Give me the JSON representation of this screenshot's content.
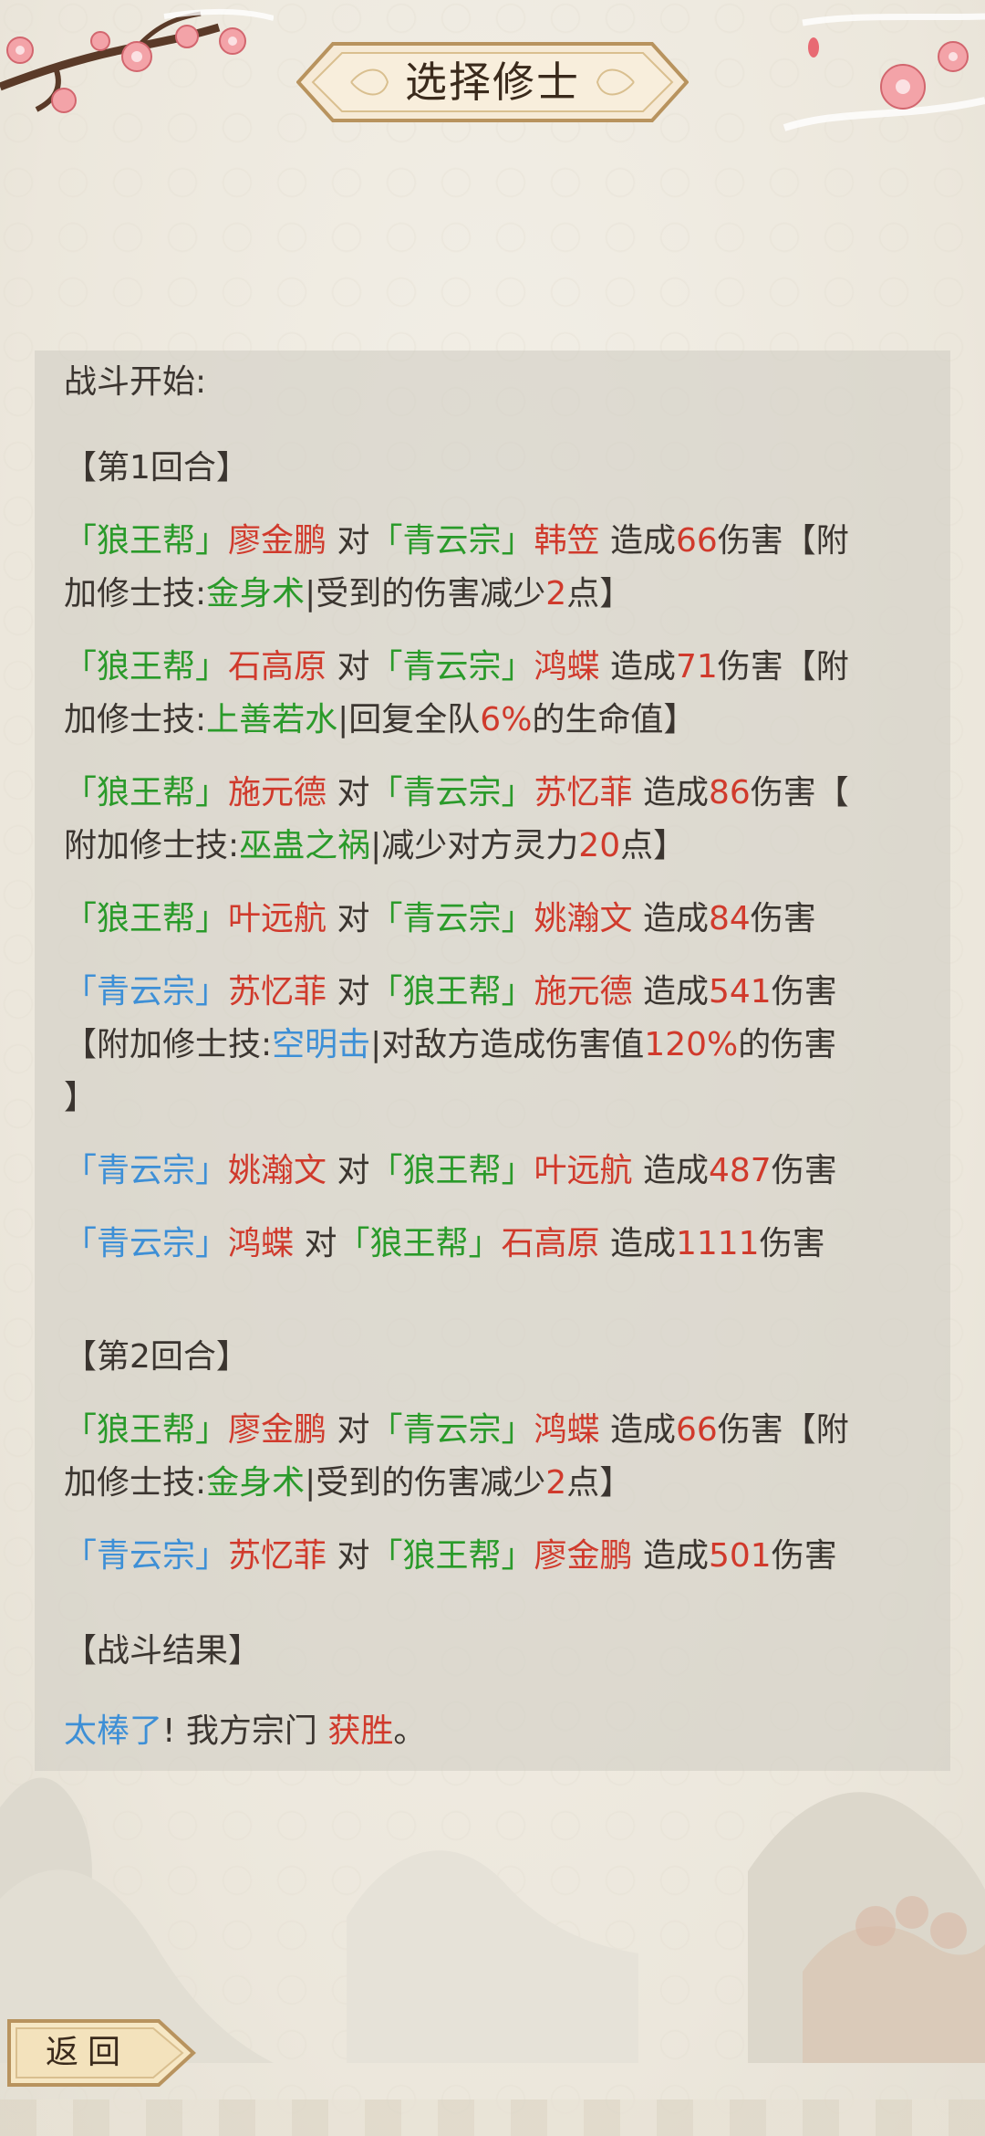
{
  "header": {
    "title": "选择修士"
  },
  "log": {
    "intro": "战斗开始:",
    "rounds": [
      {
        "title": "【第1回合】",
        "entries": [
          {
            "line1": [
              {
                "text": "「狼王帮」",
                "color": "green"
              },
              {
                "text": "廖金鹏",
                "color": "red"
              },
              {
                "text": " 对",
                "color": "plain"
              },
              {
                "text": "「青云宗」",
                "color": "green"
              },
              {
                "text": "韩笠",
                "color": "red"
              },
              {
                "text": " 造成",
                "color": "plain"
              },
              {
                "text": "66",
                "color": "red"
              },
              {
                "text": "伤害【附",
                "color": "plain"
              }
            ],
            "line2": [
              {
                "text": "加修士技:",
                "color": "plain"
              },
              {
                "text": "金身术",
                "color": "green"
              },
              {
                "text": "|受到的伤害减少",
                "color": "plain"
              },
              {
                "text": "2",
                "color": "red"
              },
              {
                "text": "点】",
                "color": "plain"
              }
            ]
          },
          {
            "line1": [
              {
                "text": "「狼王帮」",
                "color": "green"
              },
              {
                "text": "石高原",
                "color": "red"
              },
              {
                "text": " 对",
                "color": "plain"
              },
              {
                "text": "「青云宗」",
                "color": "green"
              },
              {
                "text": "鸿蝶",
                "color": "red"
              },
              {
                "text": " 造成",
                "color": "plain"
              },
              {
                "text": "71",
                "color": "red"
              },
              {
                "text": "伤害【附",
                "color": "plain"
              }
            ],
            "line2": [
              {
                "text": "加修士技:",
                "color": "plain"
              },
              {
                "text": "上善若水",
                "color": "green"
              },
              {
                "text": "|回复全队",
                "color": "plain"
              },
              {
                "text": "6%",
                "color": "red"
              },
              {
                "text": "的生命值】",
                "color": "plain"
              }
            ]
          },
          {
            "line1": [
              {
                "text": "「狼王帮」",
                "color": "green"
              },
              {
                "text": "施元德",
                "color": "red"
              },
              {
                "text": " 对",
                "color": "plain"
              },
              {
                "text": "「青云宗」",
                "color": "green"
              },
              {
                "text": "苏忆菲",
                "color": "red"
              },
              {
                "text": " 造成",
                "color": "plain"
              },
              {
                "text": "86",
                "color": "red"
              },
              {
                "text": "伤害【",
                "color": "plain"
              }
            ],
            "line2": [
              {
                "text": "附加修士技:",
                "color": "plain"
              },
              {
                "text": "巫蛊之祸",
                "color": "green"
              },
              {
                "text": "|减少对方灵力",
                "color": "plain"
              },
              {
                "text": "20",
                "color": "red"
              },
              {
                "text": "点】",
                "color": "plain"
              }
            ]
          },
          {
            "line1": [
              {
                "text": "「狼王帮」",
                "color": "green"
              },
              {
                "text": "叶远航",
                "color": "red"
              },
              {
                "text": " 对",
                "color": "plain"
              },
              {
                "text": "「青云宗」",
                "color": "green"
              },
              {
                "text": "姚瀚文",
                "color": "red"
              },
              {
                "text": " 造成",
                "color": "plain"
              },
              {
                "text": "84",
                "color": "red"
              },
              {
                "text": "伤害",
                "color": "plain"
              }
            ]
          },
          {
            "line1": [
              {
                "text": "「青云宗」",
                "color": "blue"
              },
              {
                "text": "苏忆菲",
                "color": "red"
              },
              {
                "text": " 对",
                "color": "plain"
              },
              {
                "text": "「狼王帮」",
                "color": "green"
              },
              {
                "text": "施元德",
                "color": "red"
              },
              {
                "text": " 造成",
                "color": "plain"
              },
              {
                "text": "541",
                "color": "red"
              },
              {
                "text": "伤害",
                "color": "plain"
              }
            ],
            "line2": [
              {
                "text": "【附加修士技:",
                "color": "plain"
              },
              {
                "text": "空明击",
                "color": "blue"
              },
              {
                "text": "|对敌方造成伤害值",
                "color": "plain"
              },
              {
                "text": "120%",
                "color": "red"
              },
              {
                "text": "的伤害",
                "color": "plain"
              }
            ],
            "line3": [
              {
                "text": "】",
                "color": "plain"
              }
            ]
          },
          {
            "line1": [
              {
                "text": "「青云宗」",
                "color": "blue"
              },
              {
                "text": "姚瀚文",
                "color": "red"
              },
              {
                "text": " 对",
                "color": "plain"
              },
              {
                "text": "「狼王帮」",
                "color": "green"
              },
              {
                "text": "叶远航",
                "color": "red"
              },
              {
                "text": " 造成",
                "color": "plain"
              },
              {
                "text": "487",
                "color": "red"
              },
              {
                "text": "伤害",
                "color": "plain"
              }
            ]
          },
          {
            "line1": [
              {
                "text": "「青云宗」",
                "color": "blue"
              },
              {
                "text": "鸿蝶",
                "color": "red"
              },
              {
                "text": " 对",
                "color": "plain"
              },
              {
                "text": "「狼王帮」",
                "color": "green"
              },
              {
                "text": "石高原",
                "color": "red"
              },
              {
                "text": " 造成",
                "color": "plain"
              },
              {
                "text": "1111",
                "color": "red"
              },
              {
                "text": "伤害",
                "color": "plain"
              }
            ]
          }
        ]
      },
      {
        "title": "【第2回合】",
        "entries": [
          {
            "line1": [
              {
                "text": "「狼王帮」",
                "color": "green"
              },
              {
                "text": "廖金鹏",
                "color": "red"
              },
              {
                "text": " 对",
                "color": "plain"
              },
              {
                "text": "「青云宗」",
                "color": "green"
              },
              {
                "text": "鸿蝶",
                "color": "red"
              },
              {
                "text": " 造成",
                "color": "plain"
              },
              {
                "text": "66",
                "color": "red"
              },
              {
                "text": "伤害【附",
                "color": "plain"
              }
            ],
            "line2": [
              {
                "text": "加修士技:",
                "color": "plain"
              },
              {
                "text": "金身术",
                "color": "green"
              },
              {
                "text": "|受到的伤害减少",
                "color": "plain"
              },
              {
                "text": "2",
                "color": "red"
              },
              {
                "text": "点】",
                "color": "plain"
              }
            ]
          },
          {
            "line1": [
              {
                "text": "「青云宗」",
                "color": "blue"
              },
              {
                "text": "苏忆菲",
                "color": "red"
              },
              {
                "text": " 对",
                "color": "plain"
              },
              {
                "text": "「狼王帮」",
                "color": "green"
              },
              {
                "text": "廖金鹏",
                "color": "red"
              },
              {
                "text": " 造成",
                "color": "plain"
              },
              {
                "text": "501",
                "color": "red"
              },
              {
                "text": "伤害",
                "color": "plain"
              }
            ]
          }
        ]
      }
    ],
    "result_title": "【战斗结果】",
    "result_line": [
      {
        "text": "太棒了",
        "color": "blue"
      },
      {
        "text": "! 我方宗门 ",
        "color": "plain"
      },
      {
        "text": "获胜",
        "color": "red"
      },
      {
        "text": "。",
        "color": "plain"
      }
    ]
  },
  "footer": {
    "back_label": "返回"
  },
  "colors": {
    "green": "#2a9a2a",
    "red": "#d03a2c",
    "blue": "#3d8fd6",
    "plain": "#3b3530"
  }
}
